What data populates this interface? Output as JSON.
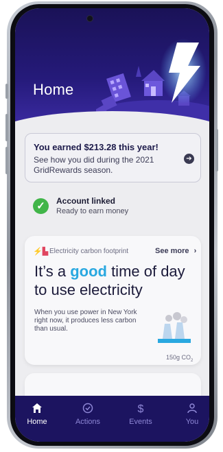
{
  "header": {
    "title": "Home"
  },
  "earned": {
    "title": "You earned $213.28 this year!",
    "subtitle": "See how you did during the 2021 GridRewards season."
  },
  "account": {
    "title": "Account linked",
    "subtitle": "Ready to earn money"
  },
  "carbon": {
    "label": "Electricity carbon footprint",
    "see_more": "See more",
    "see_more_chevron": "›",
    "headline_before": "It’s a ",
    "headline_highlight": "good",
    "headline_after": " time of day to use electricity",
    "body": "When you use power in New York right now, it produces less carbon than usual.",
    "co2_amount": "150g CO",
    "co2_sub": "2"
  },
  "tabs": [
    {
      "label": "Home",
      "icon": "home-icon",
      "active": true
    },
    {
      "label": "Actions",
      "icon": "check-circle-icon",
      "active": false
    },
    {
      "label": "Events",
      "icon": "dollar-icon",
      "active": false
    },
    {
      "label": "You",
      "icon": "person-icon",
      "active": false
    }
  ],
  "colors": {
    "header": "#1a1257",
    "tabbar": "#1c1460",
    "good": "#29a8e0",
    "check": "#41b549"
  }
}
